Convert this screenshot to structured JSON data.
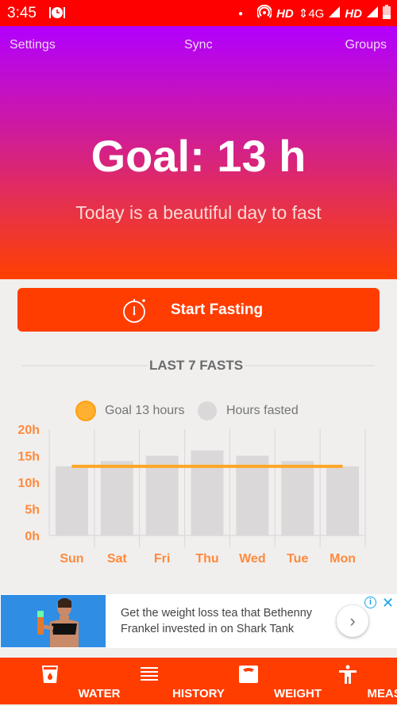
{
  "status_bar": {
    "time": "3:45",
    "network": "HD",
    "network_type": "4G",
    "network2": "HD"
  },
  "header": {
    "nav": {
      "settings": "Settings",
      "sync": "Sync",
      "groups": "Groups"
    },
    "goal_title": "Goal: 13 h",
    "tagline": "Today is a beautiful day to fast"
  },
  "start_button": {
    "label": "Start Fasting",
    "icon": "stopwatch-icon"
  },
  "section_title": "LAST 7 FASTS",
  "legend": {
    "goal_label": "Goal 13 hours",
    "hours_label": "Hours fasted"
  },
  "colors": {
    "accent": "#ff3d00",
    "goal_line": "#ffa726",
    "bar": "#dad8d8",
    "axis_label": "#ff8a3d"
  },
  "chart_data": {
    "type": "bar",
    "title": "LAST 7 FASTS",
    "categories": [
      "Sun",
      "Sat",
      "Fri",
      "Thu",
      "Wed",
      "Tue",
      "Mon"
    ],
    "series": [
      {
        "name": "Hours fasted",
        "values": [
          13,
          14,
          15,
          16,
          15,
          14,
          13
        ]
      },
      {
        "name": "Goal 13 hours",
        "type": "line",
        "values": [
          13,
          13,
          13,
          13,
          13,
          13,
          13
        ]
      }
    ],
    "yticks": [
      "0h",
      "5h",
      "10h",
      "15h",
      "20h"
    ],
    "ylim": [
      0,
      20
    ],
    "xlabel": "",
    "ylabel": "",
    "legend": "top-center",
    "grid": "vertical"
  },
  "ad": {
    "text": "Get the weight loss tea that Bethenny Frankel invested in on Shark Tank",
    "info_icon": "ⓘ",
    "close_icon": "✕",
    "arrow": "›"
  },
  "bottom_nav": [
    {
      "label": "WATER",
      "icon": "water-glass-icon"
    },
    {
      "label": "HISTORY",
      "icon": "list-icon"
    },
    {
      "label": "WEIGHT",
      "icon": "scale-icon"
    },
    {
      "label": "MEASURE",
      "icon": "body-measure-icon"
    }
  ]
}
